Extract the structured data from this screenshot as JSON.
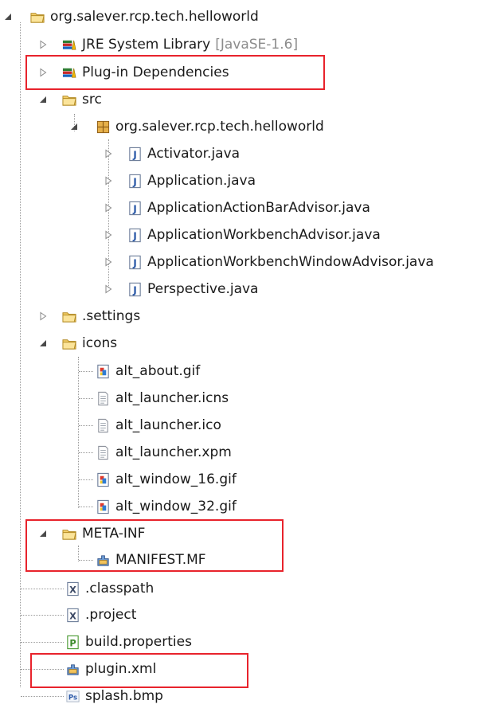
{
  "tree": {
    "project": {
      "label": "org.salever.rcp.tech.helloworld"
    },
    "jre": {
      "label": "JRE System Library",
      "decoration": "[JavaSE-1.6]"
    },
    "plugin_deps": {
      "label": "Plug-in Dependencies"
    },
    "src": {
      "label": "src",
      "package": {
        "label": "org.salever.rcp.tech.helloworld",
        "files": [
          "Activator.java",
          "Application.java",
          "ApplicationActionBarAdvisor.java",
          "ApplicationWorkbenchAdvisor.java",
          "ApplicationWorkbenchWindowAdvisor.java",
          "Perspective.java"
        ]
      }
    },
    "settings": {
      "label": ".settings"
    },
    "icons": {
      "label": "icons",
      "files": [
        "alt_about.gif",
        "alt_launcher.icns",
        "alt_launcher.ico",
        "alt_launcher.xpm",
        "alt_window_16.gif",
        "alt_window_32.gif"
      ]
    },
    "meta_inf": {
      "label": "META-INF",
      "manifest": "MANIFEST.MF"
    },
    "classpath": {
      "label": ".classpath"
    },
    "project_file": {
      "label": ".project"
    },
    "build_properties": {
      "label": "build.properties"
    },
    "plugin_xml": {
      "label": "plugin.xml"
    },
    "splash": {
      "label": "splash.bmp"
    }
  },
  "colors": {
    "highlight": "#e8232c",
    "decoration": "#8c8c8c"
  }
}
